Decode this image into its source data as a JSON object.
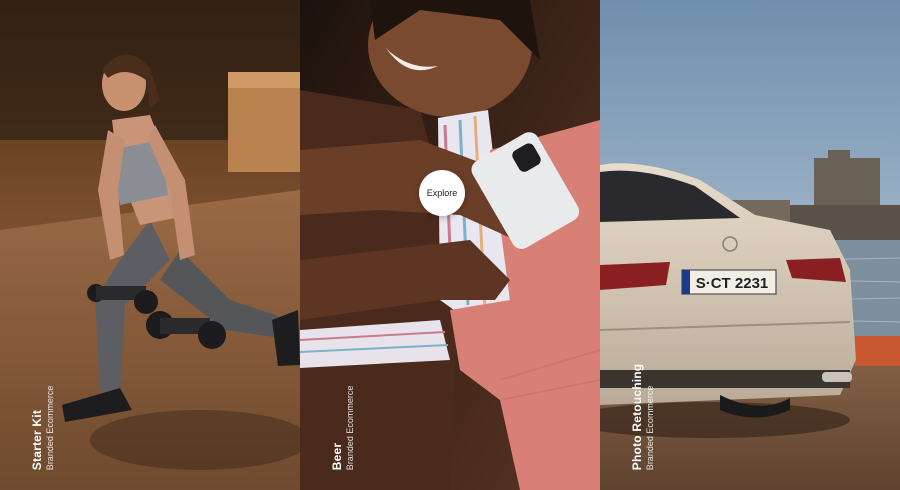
{
  "panels": [
    {
      "title": "Starter Kit",
      "subtitle": "Branded Ecommerce",
      "image": "woman-lunging-with-dumbbells"
    },
    {
      "title": "Beer",
      "subtitle": "Branded Ecommerce",
      "image": "woman-hugging-holding-phone",
      "explore_label": "Explore"
    },
    {
      "title": "Photo Retouching",
      "subtitle": "Branded Ecommerce",
      "image": "mercedes-car-rear-waterfront",
      "license_plate": "S·CT 2231"
    }
  ],
  "colors": {
    "panel1_bg": "#6a4528",
    "panel2_bg": "#3a2218",
    "panel3_sky": "#9bb2c8",
    "button_bg": "#ffffff"
  }
}
